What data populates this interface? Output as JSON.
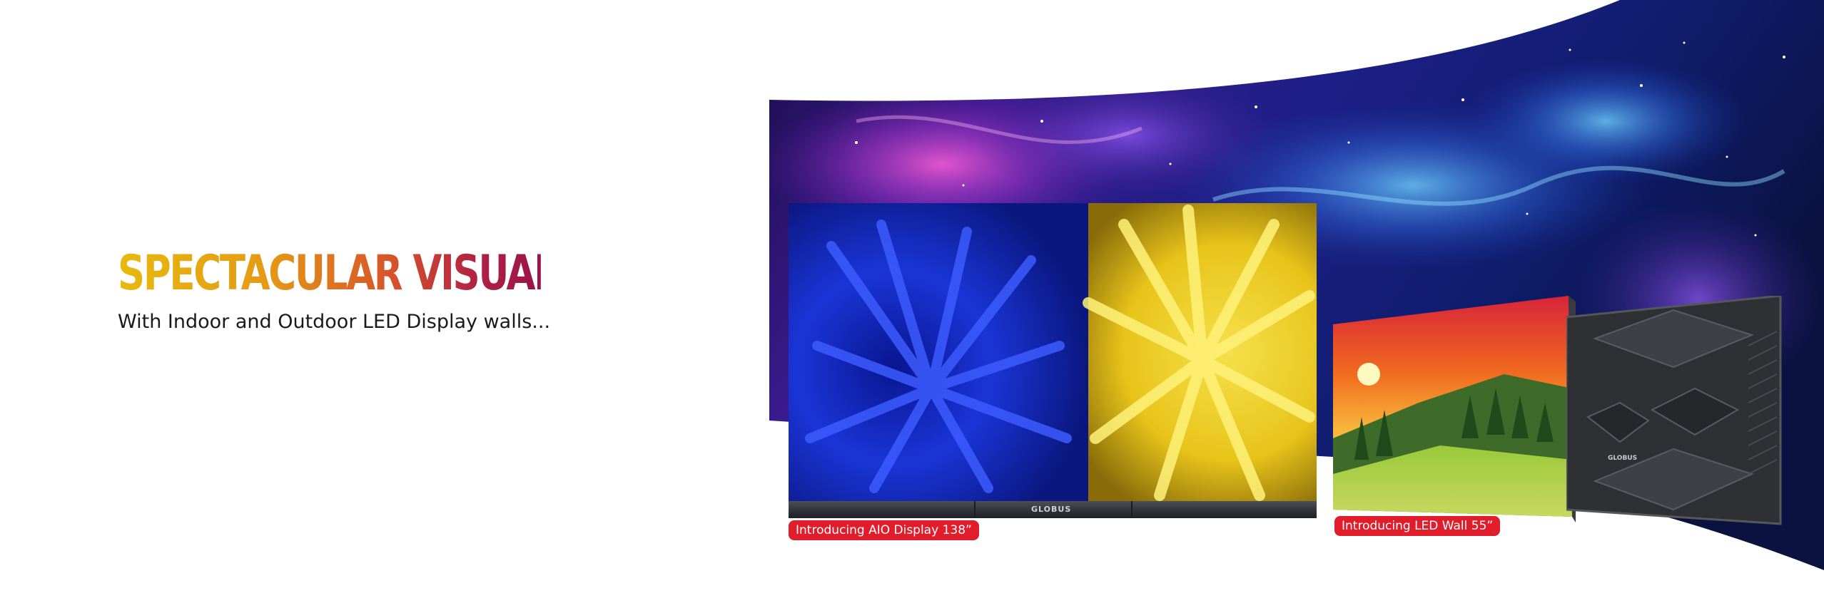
{
  "hero": {
    "headline": "SPECTACULAR VISUALS",
    "subheadline": "With Indoor and Outdoor LED Display walls..."
  },
  "products": [
    {
      "badge": "Introducing AIO Display 138”",
      "brand_mark": "GLOBUS"
    },
    {
      "badge": "Introducing LED Wall 55”",
      "brand_mark": "GLOBUS"
    }
  ],
  "colors": {
    "headline_gradient": [
      "#e8b90e",
      "#e59a14",
      "#d6532a",
      "#b02144",
      "#9a1349"
    ],
    "badge_bg": "#e21d2b",
    "badge_text": "#ffffff",
    "subheadline_text": "#1a1a1a"
  }
}
